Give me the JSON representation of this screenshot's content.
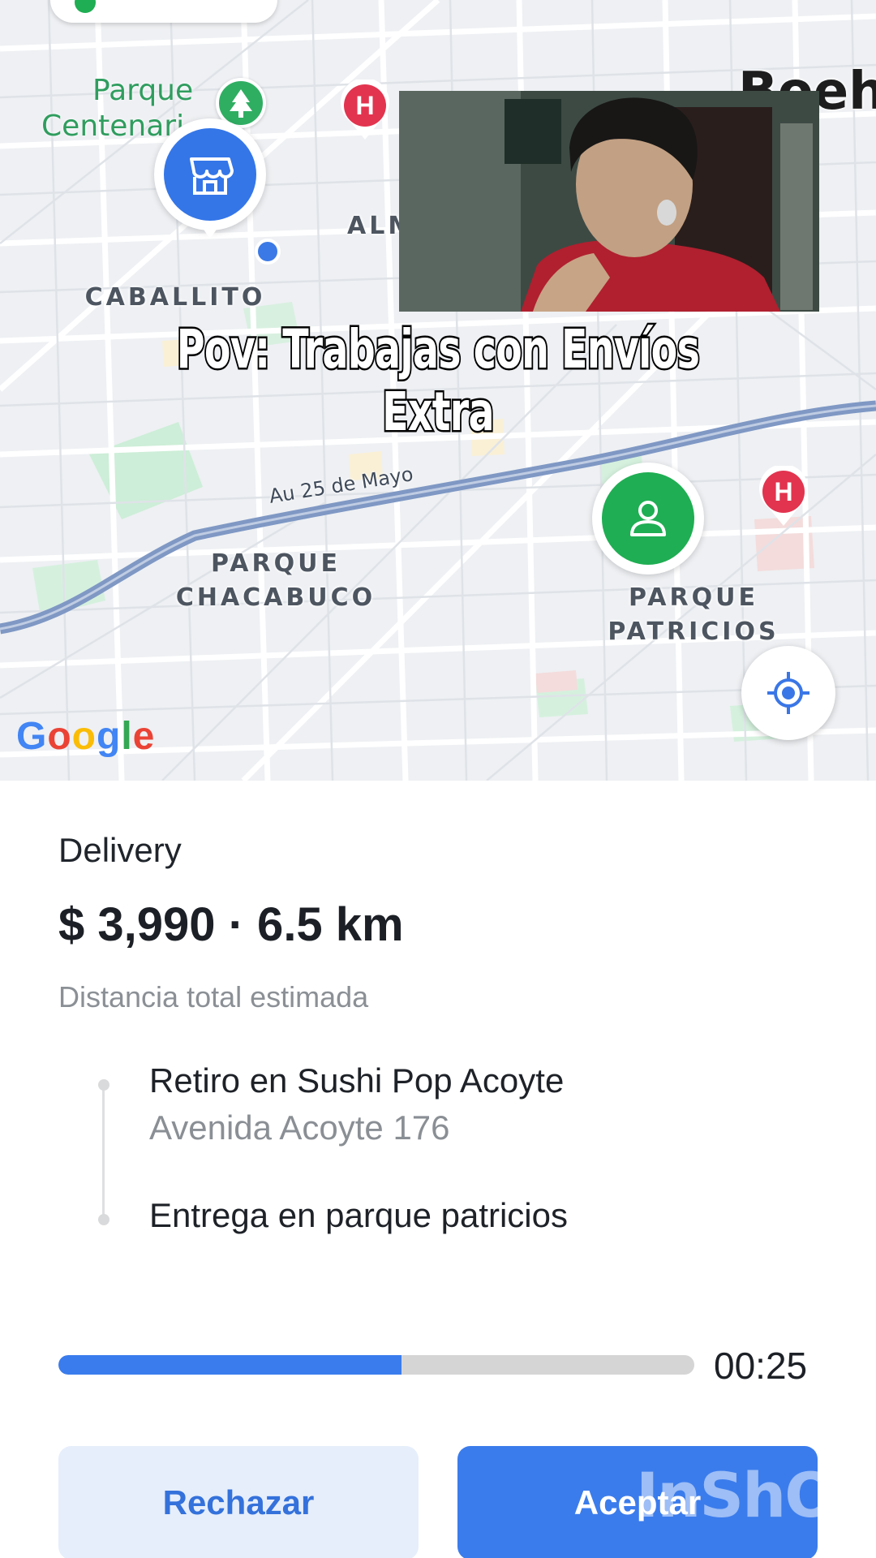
{
  "map": {
    "area_labels": {
      "caballito": "CABALLITO",
      "almagro_partial": "ALM",
      "parque_chacabuco_line1": "PARQUE",
      "parque_chacabuco_line2": "CHACABUCO",
      "parque_patricios_line1": "PARQUE",
      "parque_patricios_line2": "PATRICIOS",
      "top_right_partial": "Boeh"
    },
    "park_label_line1": "Parque",
    "park_label_line2": "Centenari",
    "road_label": "Au 25 de Mayo",
    "hospital_badge": "H",
    "google_logo": {
      "G": "G",
      "o1": "o",
      "o2": "o",
      "g": "g",
      "l": "l",
      "e": "e"
    },
    "colors": {
      "store_marker": "#3476e8",
      "customer_marker": "#1fae53",
      "hospital_pin": "#e2344f",
      "highway": "#7f98c4"
    },
    "icons": {
      "store": "store-icon",
      "customer": "person-icon",
      "recenter": "my-location-icon",
      "park": "tree-icon",
      "hospital": "hospital-icon"
    }
  },
  "overlay": {
    "caption": "Pov: Trabajas con Envíos Extra",
    "watermark": "InShOt"
  },
  "order": {
    "service": "Delivery",
    "price_distance": "$ 3,990 · 6.5 km",
    "distance_label": "Distancia total estimada",
    "pickup_title": "Retiro en Sushi Pop Acoyte",
    "pickup_address": "Avenida Acoyte 176",
    "dropoff_title": "Entrega en parque patricios"
  },
  "timer": {
    "progress_fraction": 0.54,
    "time_text": "00:25"
  },
  "actions": {
    "reject_label": "Rechazar",
    "accept_label": "Aceptar"
  }
}
